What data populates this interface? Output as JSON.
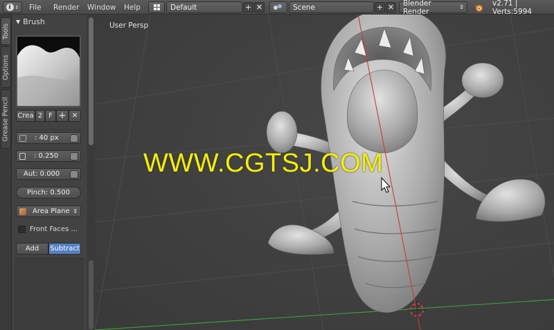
{
  "menu": {
    "items": [
      "File",
      "Render",
      "Window",
      "Help"
    ]
  },
  "layout": {
    "value": "Default"
  },
  "scene": {
    "value": "Scene"
  },
  "engine": {
    "value": "Blender Render"
  },
  "stats": {
    "text": "v2.71 | Verts:5994"
  },
  "side_tabs": [
    "Tools",
    "Options",
    "Grease Pencil"
  ],
  "brush": {
    "panel_title": "Brush",
    "name_field": "Crea",
    "users": "2",
    "fake_user": "F",
    "radius": ": 40 px",
    "strength": ": 0.250",
    "autosmooth": "Aut: 0.000",
    "pinch": "Pinch: 0.500",
    "plane": "Area Plane",
    "front_faces": "Front Faces ...",
    "mode_add": "Add",
    "mode_subtract": "Subtract"
  },
  "viewport": {
    "label": "User Persp",
    "watermark": "WWW.CGTSJ.COM"
  },
  "colors": {
    "accent_blue": "#5680c2",
    "watermark_yellow": "#f5f000"
  }
}
